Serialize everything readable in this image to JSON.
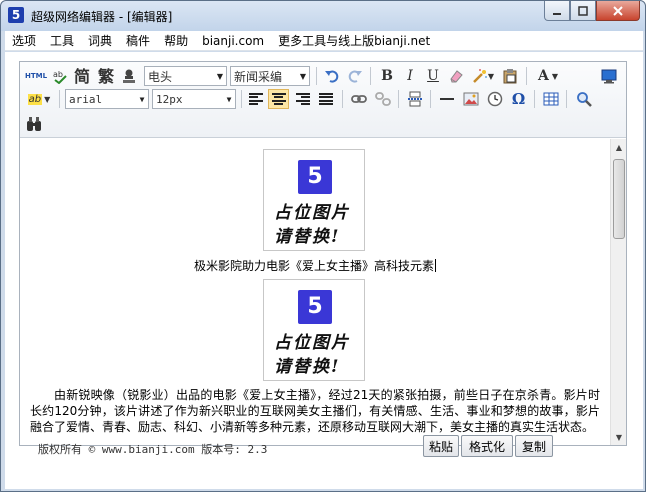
{
  "window": {
    "title": "超级网络编辑器 - [编辑器]",
    "icon_glyph": "5"
  },
  "menu": {
    "items": [
      "选项",
      "工具",
      "词典",
      "稿件",
      "帮助",
      "bianji.com",
      "更多工具与线上版bianji.net"
    ]
  },
  "toolbar": {
    "html_label": "HTML",
    "simplified_label": "简",
    "traditional_label": "繁",
    "style_select": "电头",
    "template_select": "新闻采编",
    "font_family_select": "arial",
    "font_size_select": "12px",
    "bold": "B",
    "italic": "I",
    "underline": "U",
    "text_color": "A",
    "highlight": "ab",
    "omega": "Ω",
    "active_align": "center"
  },
  "document": {
    "placeholder_line1": "占位图片",
    "placeholder_line2": "请替换!",
    "caption": "极米影院助力电影《爱上女主播》高科技元素",
    "paragraph": "由新锐映像（锐影业）出品的电影《爱上女主播》，经过21天的紧张拍摄，前些日子在京杀青。影片时长约120分钟，该片讲述了作为新兴职业的互联网美女主播们，有关情感、生活、事业和梦想的故事，影片融合了爱情、青春、励志、科幻、小清新等多种元素，还原移动互联网大潮下，美女主播的真实生活状态。"
  },
  "footer": {
    "copyright": "版权所有 © www.bianji.com 版本号: 2.3",
    "paste_button": "粘贴",
    "format_button": "格式化",
    "copy_button": "复制"
  },
  "colors": {
    "logo_blue": "#3a37d6",
    "active_align_bg": "#fde7a5",
    "close_button": "#c8442e"
  }
}
